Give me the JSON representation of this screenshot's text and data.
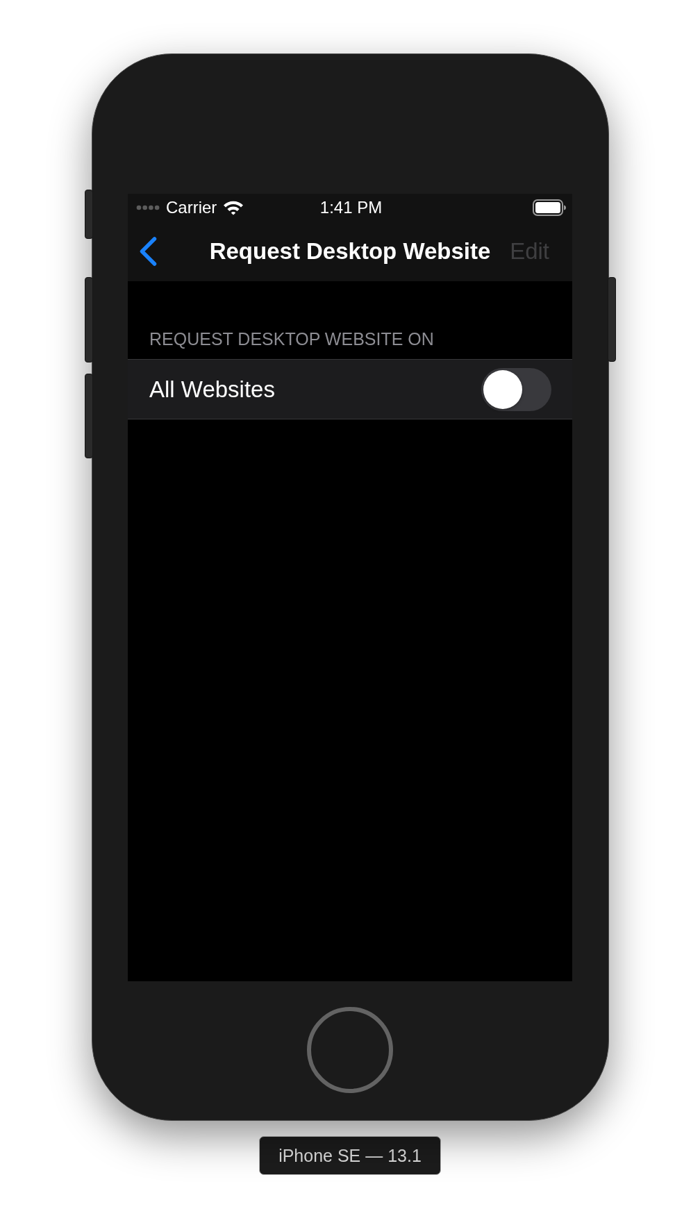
{
  "status_bar": {
    "carrier": "Carrier",
    "time": "1:41 PM"
  },
  "nav_bar": {
    "title": "Request Desktop Website",
    "edit": {
      "label": "Edit",
      "disabled": true
    }
  },
  "section": {
    "header": "REQUEST DESKTOP WEBSITE ON",
    "rows": [
      {
        "kind": "toggle",
        "label": "All Websites",
        "on": false
      }
    ]
  },
  "device_label": "iPhone SE — 13.1"
}
